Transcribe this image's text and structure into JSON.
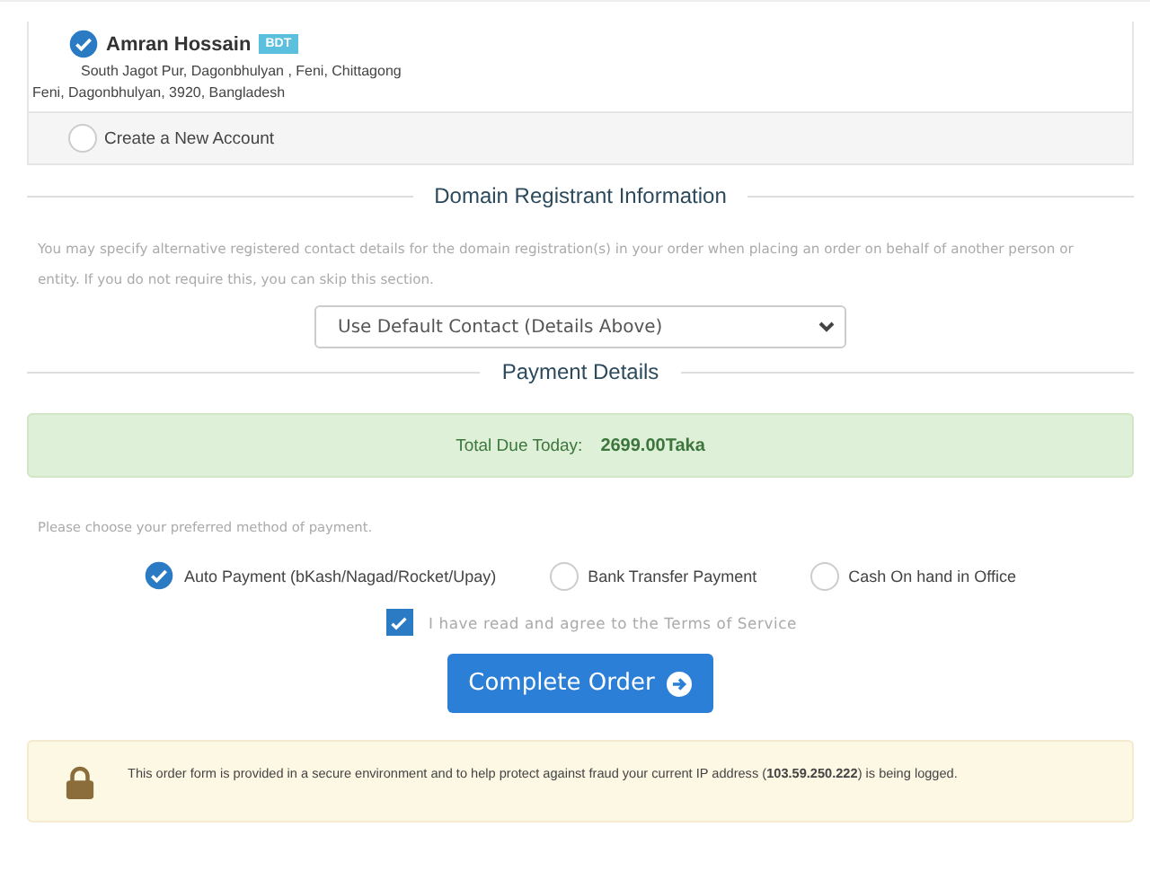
{
  "accounts": [
    {
      "name": "Amran Hossain",
      "badge": "BDT",
      "address_line_1": "South Jagot Pur, Dagonbhulyan , Feni, Chittagong",
      "address_line_2": "Feni, Dagonbhulyan, 3920, Bangladesh",
      "selected": true
    },
    {
      "name": "Create a New Account",
      "selected": false
    }
  ],
  "registrant": {
    "heading": "Domain Registrant Information",
    "description": "You may specify alternative registered contact details for the domain registration(s) in your order when placing an order on behalf of another person or entity. If you do not require this, you can skip this section.",
    "contact_select": "Use Default Contact (Details Above)"
  },
  "payment": {
    "heading": "Payment Details",
    "total_label": "Total Due Today:",
    "total_value": "2699.00Taka",
    "method_prompt": "Please choose your preferred method of payment.",
    "methods": [
      {
        "label": "Auto Payment (bKash/Nagad/Rocket/Upay)",
        "selected": true
      },
      {
        "label": "Bank Transfer Payment",
        "selected": false
      },
      {
        "label": "Cash On hand in Office",
        "selected": false
      }
    ],
    "terms": {
      "label": "I have read and agree to the Terms of Service",
      "checked": true
    },
    "submit": "Complete Order"
  },
  "security_notice": "This order form is provided in a secure environment and to help protect against fraud your current IP address (**103.59.250.222**) is being logged."
}
